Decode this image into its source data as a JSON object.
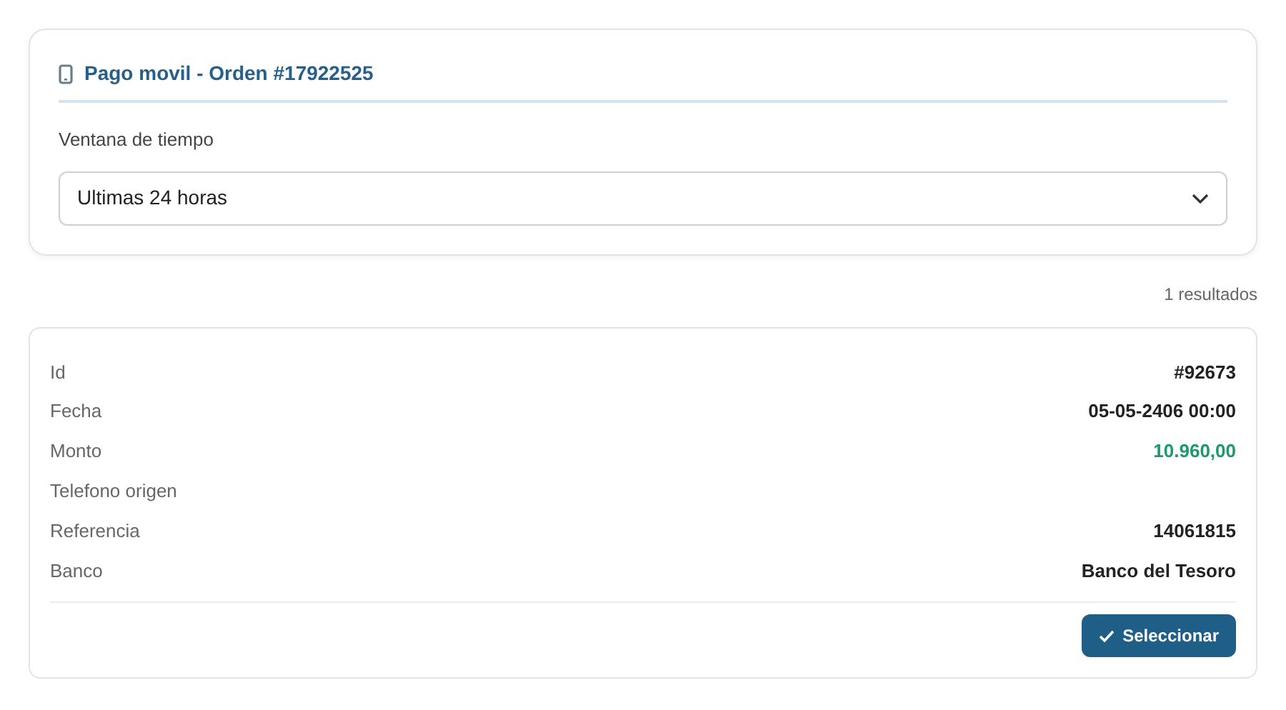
{
  "header": {
    "title": "Pago movil - Orden #17922525"
  },
  "time_window": {
    "label": "Ventana de tiempo",
    "value": "Ultimas 24 horas"
  },
  "results_count": "1 resultados",
  "results": [
    {
      "fields": [
        {
          "label": "Id",
          "value": "#92673",
          "kind": "text"
        },
        {
          "label": "Fecha",
          "value": "05-05-2406 00:00",
          "kind": "text"
        },
        {
          "label": "Monto",
          "value": "10.960,00",
          "kind": "amount"
        },
        {
          "label": "Telefono origen"
        },
        {
          "label": "Referencia",
          "value": "14061815",
          "kind": "text"
        },
        {
          "label": "Banco",
          "value": "Banco del Tesoro",
          "kind": "text"
        }
      ],
      "action": "Seleccionar"
    }
  ]
}
